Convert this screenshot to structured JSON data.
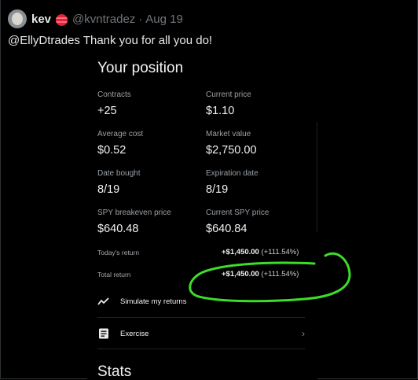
{
  "tweet": {
    "name": "kev",
    "handle": "@kvntradez",
    "separator": "·",
    "date": "Aug 19",
    "text": "@EllyDtrades Thank you for all you do!"
  },
  "position": {
    "title": "Your position",
    "fields": [
      {
        "label": "Contracts",
        "value": "+25"
      },
      {
        "label": "Current price",
        "value": "$1.10"
      },
      {
        "label": "Average cost",
        "value": "$0.52"
      },
      {
        "label": "Market value",
        "value": "$2,750.00"
      },
      {
        "label": "Date bought",
        "value": "8/19"
      },
      {
        "label": "Expiration date",
        "value": "8/19"
      },
      {
        "label": "SPY breakeven price",
        "value": "$640.48"
      },
      {
        "label": "Current SPY price",
        "value": "$640.84"
      }
    ],
    "todays_return": {
      "label": "Today's return",
      "amount": "+$1,450.00",
      "percent": "(+111.54%)"
    },
    "total_return": {
      "label": "Total return",
      "amount": "+$1,450.00",
      "percent": "(+111.54%)"
    },
    "actions": [
      {
        "label": "Simulate my returns",
        "icon": "trend-line-icon"
      },
      {
        "label": "Exercise",
        "icon": "document-icon",
        "chevron": "›"
      }
    ],
    "stats_title": "Stats"
  },
  "colors": {
    "background": "#000000",
    "text": "#e7e9ea",
    "muted": "#71767b",
    "annotation": "#3ddc2a",
    "flag": "#e0243b"
  }
}
